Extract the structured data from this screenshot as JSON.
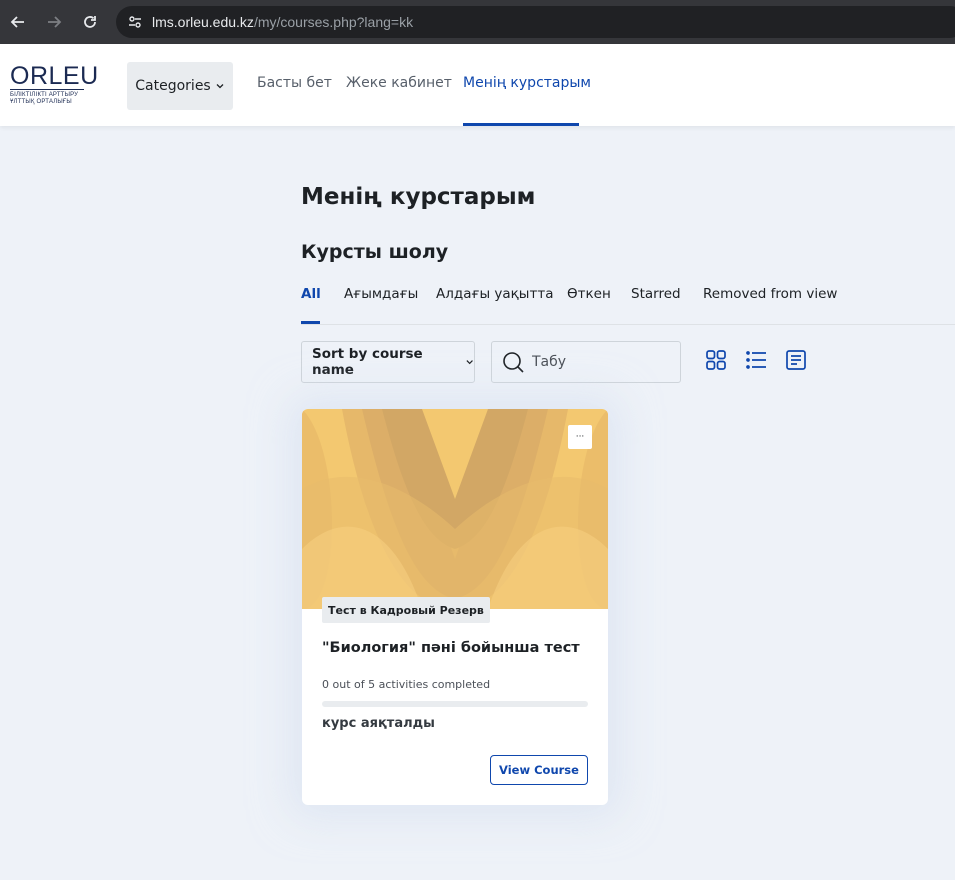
{
  "browser": {
    "url_host": "lms.orleu.edu.kz",
    "url_path": "/my/courses.php?lang=kk"
  },
  "header": {
    "logo_brand": "ORLEU",
    "logo_sub1": "БІЛІКТІЛІКТІ АРТТЫРУ",
    "logo_sub2": "ҰЛТТЫҚ ОРТАЛЫҒЫ",
    "categories_label": "Categories",
    "nav": [
      {
        "label": "Басты бет"
      },
      {
        "label": "Жеке кабинет"
      },
      {
        "label": "Менің курстарым",
        "active": true
      }
    ]
  },
  "main": {
    "page_title": "Менің курстарым",
    "section_title": "Курсты шолу",
    "tabs": [
      {
        "label": "All",
        "active": true
      },
      {
        "label": "Ағымдағы"
      },
      {
        "label": "Алдағы уақытта"
      },
      {
        "label": "Өткен"
      },
      {
        "label": "Starred"
      },
      {
        "label": "Removed from view"
      }
    ],
    "sort_label": "Sort by course name",
    "search_placeholder": "Табу",
    "view_icons": [
      "grid-view-icon",
      "list-view-icon",
      "summary-view-icon"
    ]
  },
  "course_card": {
    "menu_label": "···",
    "category": "Тест в Кадровый Резерв",
    "title": "\"Биология\" пәні бойынша тест",
    "progress_text": "0 out of 5 activities completed",
    "progress_fraction": 0,
    "status": "курс аяқталды",
    "button_label": "View Course"
  },
  "colors": {
    "accent": "#0f47ad",
    "page_bg": "#eef2f8",
    "card_image": "#f3c86f"
  }
}
